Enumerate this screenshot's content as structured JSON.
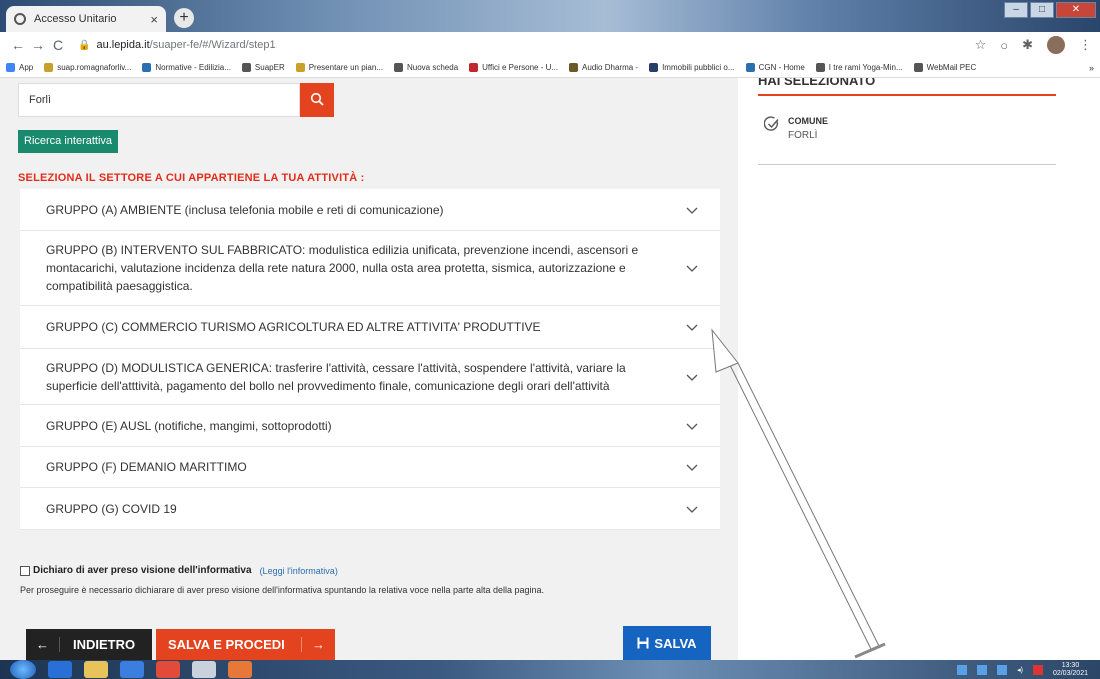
{
  "browser": {
    "tab_title": "Accesso Unitario",
    "tab_close": "×",
    "new_tab": "+",
    "url_host": "au.lepida.it",
    "url_path": "/suaper-fe/#/Wizard/step1",
    "bookmarks": [
      {
        "label": "App",
        "color": "#4285f4"
      },
      {
        "label": "suap.romagnaforliv...",
        "color": "#c8a02a"
      },
      {
        "label": "Normative - Edilizia...",
        "color": "#2a6fb0"
      },
      {
        "label": "SuapER",
        "color": "#555555"
      },
      {
        "label": "Presentare un pian...",
        "color": "#c8a02a"
      },
      {
        "label": "Nuova scheda",
        "color": "#555555"
      },
      {
        "label": "Uffici e Persone - U...",
        "color": "#c0282d"
      },
      {
        "label": "Audio Dharma -",
        "color": "#6a5a2a"
      },
      {
        "label": "Immobili pubblici o...",
        "color": "#2a3e6a"
      },
      {
        "label": "CGN - Home",
        "color": "#2a6fb0"
      },
      {
        "label": "I tre rami Yoga-Min...",
        "color": "#555555"
      },
      {
        "label": "WebMail PEC",
        "color": "#555555"
      }
    ],
    "bookmarks_more": "»"
  },
  "search": {
    "value": "Forlì"
  },
  "ricerca_button": "Ricerca interattiva",
  "section_title": "SELEZIONA IL SETTORE A CUI APPARTIENE LA TUA ATTIVITÀ :",
  "groups": [
    {
      "label": "GRUPPO (A) AMBIENTE (inclusa telefonia mobile e reti di comunicazione)"
    },
    {
      "label": "GRUPPO (B) INTERVENTO SUL FABBRICATO: modulistica edilizia unificata, prevenzione incendi, ascensori e montacarichi, valutazione incidenza della rete natura 2000, nulla osta area protetta, sismica, autorizzazione e compatibilità paesaggistica."
    },
    {
      "label": "GRUPPO (C) COMMERCIO TURISMO AGRICOLTURA ED ALTRE ATTIVITA' PRODUTTIVE"
    },
    {
      "label": "GRUPPO (D) MODULISTICA GENERICA: trasferire l'attività, cessare l'attività, sospendere l'attività, variare la superficie dell'atttività, pagamento del bollo nel provvedimento finale, comunicazione degli orari dell'attività"
    },
    {
      "label": "GRUPPO (E) AUSL (notifiche, mangimi, sottoprodotti)"
    },
    {
      "label": "GRUPPO (F) DEMANIO MARITTIMO"
    },
    {
      "label": "GRUPPO (G) COVID 19"
    }
  ],
  "privacy": {
    "label": "Dichiaro di aver preso visione dell'informativa",
    "link": "(Leggi l'informativa)",
    "note": "Per proseguire è necessario dichiarare di aver preso visione dell'informativa spuntando la relativa voce nella parte alta della pagina."
  },
  "buttons": {
    "back_arrow": "←",
    "back": "INDIETRO",
    "next": "SALVA E PROCEDI",
    "next_arrow": "→",
    "save": "SALVA"
  },
  "right_panel": {
    "title": "HAI SELEZIONATO",
    "item_label": "COMUNE",
    "item_value": "FORLÌ"
  },
  "taskbar": {
    "time": "13:30",
    "date": "02/03/2021"
  },
  "colors": {
    "accent_red": "#e3431e",
    "green": "#1a8a6e",
    "blue": "#1464c0"
  }
}
